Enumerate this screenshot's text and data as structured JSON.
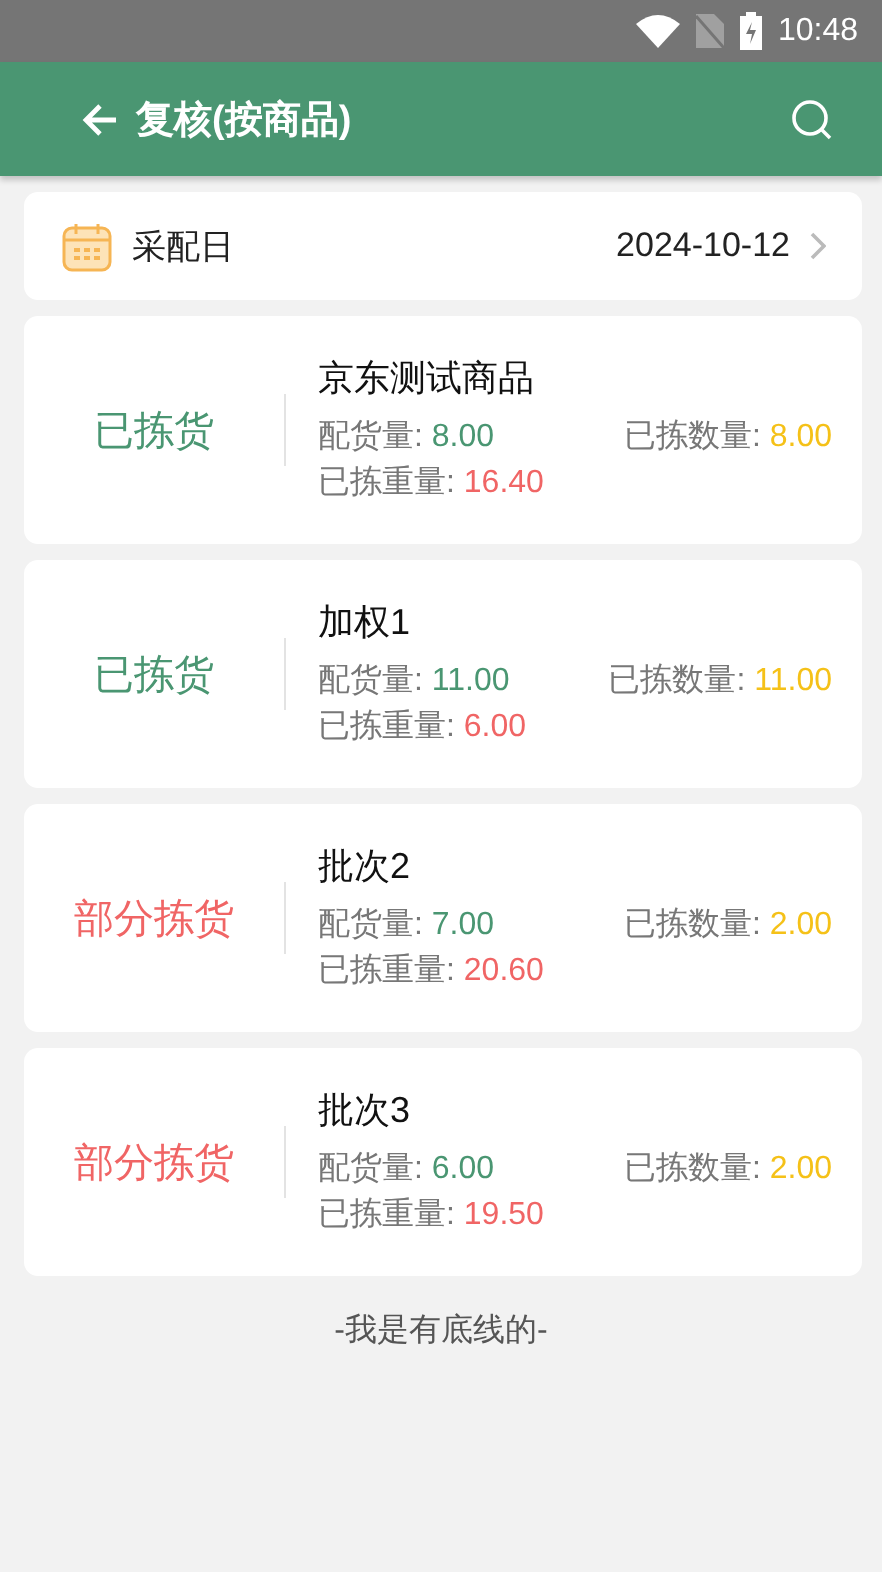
{
  "status_bar": {
    "time": "10:48"
  },
  "header": {
    "title": "复核(按商品)"
  },
  "date_filter": {
    "label": "采配日",
    "value": "2024-10-12"
  },
  "items": [
    {
      "status": "已拣货",
      "kind": "picked",
      "name": "京东测试商品",
      "allocated": {
        "label": "配货量:",
        "value": "8.00"
      },
      "picked_count": {
        "label": "已拣数量:",
        "value": "8.00"
      },
      "picked_weight": {
        "label": "已拣重量:",
        "value": "16.40"
      }
    },
    {
      "status": "已拣货",
      "kind": "picked",
      "name": "加权1",
      "allocated": {
        "label": "配货量:",
        "value": "11.00"
      },
      "picked_count": {
        "label": "已拣数量:",
        "value": "11.00"
      },
      "picked_weight": {
        "label": "已拣重量:",
        "value": "6.00"
      }
    },
    {
      "status": "部分拣货",
      "kind": "partial",
      "name": "批次2",
      "allocated": {
        "label": "配货量:",
        "value": "7.00"
      },
      "picked_count": {
        "label": "已拣数量:",
        "value": "2.00"
      },
      "picked_weight": {
        "label": "已拣重量:",
        "value": "20.60"
      }
    },
    {
      "status": "部分拣货",
      "kind": "partial",
      "name": "批次3",
      "allocated": {
        "label": "配货量:",
        "value": "6.00"
      },
      "picked_count": {
        "label": "已拣数量:",
        "value": "2.00"
      },
      "picked_weight": {
        "label": "已拣重量:",
        "value": "19.50"
      }
    }
  ],
  "footer": "-我是有底线的-"
}
